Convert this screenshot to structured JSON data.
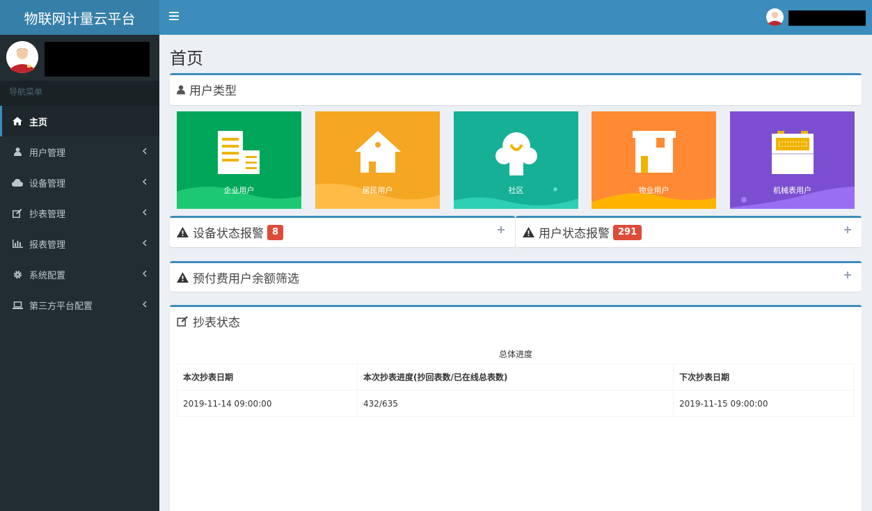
{
  "app": {
    "title": "物联网计量云平台"
  },
  "sidebar": {
    "nav_header": "导航菜单",
    "items": [
      {
        "label": "主页",
        "icon": "home-icon",
        "active": true
      },
      {
        "label": "用户管理",
        "icon": "user-icon"
      },
      {
        "label": "设备管理",
        "icon": "cloud-icon"
      },
      {
        "label": "抄表管理",
        "icon": "edit-icon"
      },
      {
        "label": "报表管理",
        "icon": "bar-chart-icon"
      },
      {
        "label": "系统配置",
        "icon": "gear-icon"
      },
      {
        "label": "第三方平台配置",
        "icon": "laptop-icon"
      }
    ]
  },
  "page": {
    "title": "首页"
  },
  "user_types": {
    "title": "用户类型",
    "tiles": [
      {
        "label": "企业用户",
        "color": "#00a65a",
        "icon": "building-icon"
      },
      {
        "label": "居民用户",
        "color": "#f5a623",
        "icon": "house-icon"
      },
      {
        "label": "社区",
        "color": "#15b096",
        "icon": "tree-icon"
      },
      {
        "label": "物业用户",
        "color": "#ff8a33",
        "icon": "shop-icon"
      },
      {
        "label": "机械表用户",
        "color": "#7b4fd0",
        "icon": "meter-icon"
      }
    ]
  },
  "device_alarm": {
    "title": "设备状态报警",
    "count": "8"
  },
  "user_alarm": {
    "title": "用户状态报警",
    "count": "291"
  },
  "prepaid": {
    "title": "预付费用户余额筛选"
  },
  "reading": {
    "title": "抄表状态",
    "subtitle": "总体进度",
    "columns": [
      "本次抄表日期",
      "本次抄表进度(抄回表数/已在线总表数)",
      "下次抄表日期"
    ],
    "rows": [
      [
        "2019-11-14 09:00:00",
        "432/635",
        "2019-11-15 09:00:00"
      ]
    ]
  }
}
